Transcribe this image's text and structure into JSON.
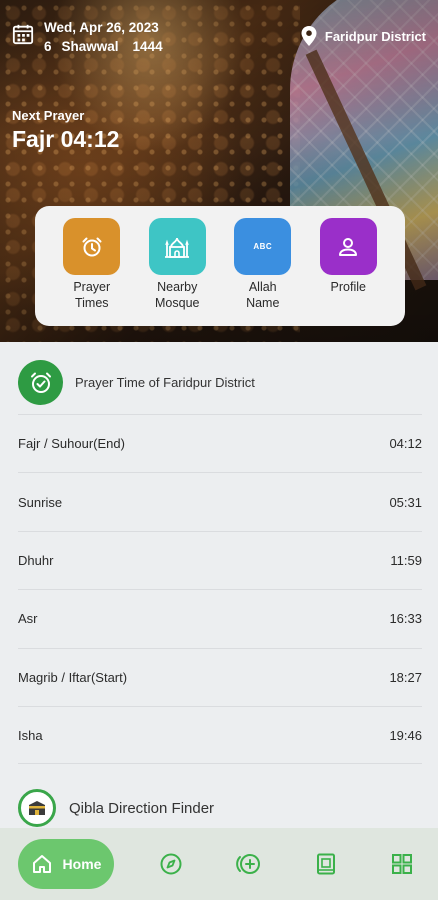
{
  "header": {
    "date": "Wed, Apr 26, 2023",
    "hijri_day": "6",
    "hijri_month": "Shawwal",
    "hijri_year": "1444",
    "location": "Faridpur District"
  },
  "next_prayer": {
    "label": "Next Prayer",
    "value": "Fajr 04:12"
  },
  "quick_actions": [
    {
      "label": "Prayer\nTimes",
      "icon": "alarm-clock-icon",
      "color": "#d9912b"
    },
    {
      "label": "Nearby\nMosque",
      "icon": "mosque-icon",
      "color": "#3ec5c5"
    },
    {
      "label": "Allah\nName",
      "icon": "abc-icon",
      "color": "#3b8fe0",
      "icon_text": "ABC"
    },
    {
      "label": "Profile",
      "icon": "person-icon",
      "color": "#9a2fc9"
    }
  ],
  "prayer_section": {
    "title": "Prayer Time of Faridpur District",
    "icon": "alarm-check-icon",
    "rows": [
      {
        "name": "Fajr / Suhour(End)",
        "time": "04:12"
      },
      {
        "name": "Sunrise",
        "time": "05:31"
      },
      {
        "name": "Dhuhr",
        "time": "11:59"
      },
      {
        "name": "Asr",
        "time": "16:33"
      },
      {
        "name": "Magrib / Iftar(Start)",
        "time": "18:27"
      },
      {
        "name": "Isha",
        "time": "19:46"
      }
    ]
  },
  "qibla": {
    "title": "Qibla Direction Finder",
    "icon": "kaaba-icon"
  },
  "bottom_nav": {
    "home_label": "Home",
    "items": [
      "home-icon",
      "compass-icon",
      "tasbih-counter-icon",
      "quran-book-icon",
      "grid-menu-icon"
    ],
    "accent": "#3bb14a"
  },
  "colors": {
    "green": "#2e9b43",
    "nav_bg": "#dfe6df",
    "home_pill": "#6cc76e"
  }
}
